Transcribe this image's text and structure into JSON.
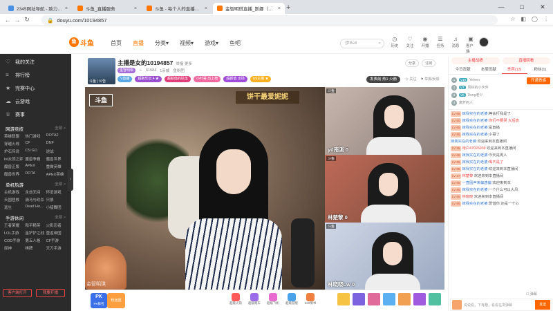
{
  "browser": {
    "tabs": [
      {
        "title": "2345网址导航 - 致力于打造百年品牌",
        "color": "#4a90e2"
      },
      {
        "title": "斗鱼_直播服务",
        "color": "#f70"
      },
      {
        "title": "斗鱼 - 每个人的直播平台",
        "color": "#f70"
      },
      {
        "title": "金智明琪直播_斯娜（揭秘） ",
        "color": "#f70"
      }
    ],
    "close_glyph": "×",
    "new_tab": "+",
    "url": "douyu.com/10194857",
    "window_controls": [
      "—",
      "□",
      "✕"
    ]
  },
  "site": {
    "logo_text": "斗鱼",
    "nav": [
      {
        "label": "首页",
        "active": false
      },
      {
        "label": "直播",
        "active": true
      },
      {
        "label": "分类▾",
        "active": false
      },
      {
        "label": "视频▾",
        "active": false
      },
      {
        "label": "游戏▾",
        "active": false
      },
      {
        "label": "鱼吧",
        "active": false
      }
    ],
    "search_placeholder": "伊Bell",
    "top_icons": [
      {
        "icon": "clock-icon",
        "glyph": "◷",
        "label": "历史"
      },
      {
        "icon": "heart-icon",
        "glyph": "♡",
        "label": "关注"
      },
      {
        "icon": "broadcast-icon",
        "glyph": "◉",
        "label": "开播"
      },
      {
        "icon": "task-icon",
        "glyph": "☰",
        "label": "任务"
      },
      {
        "icon": "bell-icon",
        "glyph": "♫",
        "label": "消息"
      },
      {
        "icon": "app-icon",
        "glyph": "▣",
        "label": "客户端"
      }
    ]
  },
  "sidebar": {
    "items": [
      {
        "icon": "heart-icon",
        "glyph": "♡",
        "label": "我的关注"
      },
      {
        "icon": "rank-icon",
        "glyph": "≡",
        "label": "排行榜"
      },
      {
        "icon": "event-icon",
        "glyph": "★",
        "label": "完赛中心"
      },
      {
        "icon": "cloud-icon",
        "glyph": "☁",
        "label": "云游戏"
      },
      {
        "icon": "trophy-icon",
        "glyph": "♕",
        "label": "赛事"
      }
    ],
    "sections": [
      {
        "title": "网游竞技",
        "more": "全部 >",
        "games": [
          "英雄联盟",
          "热门游戏",
          "DOTA2",
          "穿越火线",
          "CF",
          "DNF",
          "炉石传说",
          "CS:GO",
          "逆战",
          "lol云顶之弈",
          "魔兽争霸",
          "魔兽世界",
          "魔兽正版",
          "APEX",
          "重做英雄",
          "魔兽世界",
          "DOTA",
          "APEX英雄"
        ]
      },
      {
        "title": "单机热游",
        "more": "全部 >",
        "games": [
          "主机游戏",
          "永劫无间",
          "怀旧游戏",
          "天国拯救",
          "骑马与砍杀",
          "只狼",
          "逃生",
          "Dead Ho...",
          "小猎舞团"
        ]
      },
      {
        "title": "手游休闲",
        "more": "全部 >",
        "games": [
          "王者荣耀",
          "和平精英",
          "火影忍者",
          "LOL手游",
          "金铲铲之战",
          "重返帝国",
          "COD手游",
          "第五人格",
          "CF手游",
          "原神",
          "棋牌",
          "天刀手游"
        ]
      }
    ],
    "bottom_buttons": [
      "客户端打开",
      "我要开播"
    ]
  },
  "room": {
    "thumb_label": "斗鱼 | 公告",
    "title": "主播是女的10194857",
    "title_sub": "举报  更多",
    "badge": "金智明琪",
    "meta": [
      "61584",
      "1亲戚",
      "鱼粉团"
    ],
    "tags": [
      {
        "label": "V直播",
        "color": "#5aa9e6"
      },
      {
        "label": "超跑乐坛 4 ★",
        "color": "#9b4fd1"
      },
      {
        "label": "超颜值的队伍",
        "color": "#e0407a"
      },
      {
        "label": "小叶哥 出上榜",
        "color": "#f06aa0"
      },
      {
        "label": "超颜值 出场",
        "color": "#9f4dd8"
      },
      {
        "label": "lv6主播 ★",
        "color": "#ffb020"
      }
    ],
    "rank_pill": "发表前 热1 火箭",
    "header_buttons": [
      "分享",
      "订阅"
    ],
    "header_ops": [
      "☆ 关注",
      "⚑ 举报/反馈"
    ]
  },
  "player": {
    "logo": "斗鱼",
    "caption": "饼干最爱妮妮",
    "watermark": "金智明琪",
    "subs": [
      {
        "name": "yd南溪 0",
        "tag": "斗鱼"
      },
      {
        "name": "林楚黎 0",
        "tag": "斗鱼"
      },
      {
        "name": "林晓晓Lw 0",
        "tag": "斗鱼"
      }
    ]
  },
  "giftbar": {
    "pk_title": "PK",
    "pk_sub": "PK排名",
    "fan": "粉丝团",
    "gifts": [
      "超级火箭",
      "超级跑车",
      "超级飞机",
      "超级游艇",
      "520情书"
    ],
    "gift_colors": [
      "#ff5a5a",
      "#9c6ce8",
      "#e86cd0",
      "#4aa3e8",
      "#f08040"
    ],
    "gifts2_colors": [
      "#f6c343",
      "#7d62e0",
      "#e06b9a",
      "#5ab0f0",
      "#f0a050",
      "#a05ae0",
      "#50c0a0"
    ]
  },
  "chat": {
    "top_buttons": [
      "主播战绩",
      "直播回看"
    ],
    "tabs": [
      {
        "label": "今日贡献",
        "active": false
      },
      {
        "label": "本周贡献",
        "active": false
      },
      {
        "label": "贵宾(13)",
        "active": true
      },
      {
        "label": "粉丝(1)",
        "active": false
      }
    ],
    "open_button": "开通贵族",
    "ranks": [
      {
        "n": "1",
        "lv": "V10",
        "name": "Yelven"
      },
      {
        "n": "2",
        "lv": "V7",
        "name": "风铃的小伙伴"
      },
      {
        "n": "3",
        "lv": "V5",
        "name": "Dong老少"
      },
      {
        "n": "4",
        "lv": "",
        "name": "离开的人"
      }
    ],
    "messages": [
      {
        "lv": "LV 65",
        "user": "嫁我实在的老婆:",
        "text": "等会打我是了"
      },
      {
        "lv": "LV 50",
        "user": "嫁我实在的老婆:",
        "text": "你们不要哭 大后放"
      },
      {
        "lv": "LV 65",
        "user": "嫁我实在的老婆:",
        "text": "是直播"
      },
      {
        "lv": "LV 65",
        "user": "嫁我实在的老婆:",
        "text": "小哥了"
      },
      {
        "lv": "",
        "user": "嫁我实在的老婆:",
        "text": "欢迎来到本直播间"
      },
      {
        "lv": "LV 25",
        "user": "用户47026939",
        "text": "欢迎来到本直播间"
      },
      {
        "lv": "LV 66",
        "user": "嫁我实在的老婆:",
        "text": "今天是周人"
      },
      {
        "lv": "LV 65",
        "user": "嫁我实在的老婆:",
        "text": "喝不是了"
      },
      {
        "lv": "LV 65",
        "user": "嫁我实在的老婆:",
        "text": "欢迎来到本直播间"
      },
      {
        "lv": "LV 27",
        "user": "林楚黎",
        "text": "欢迎来到本直播间"
      },
      {
        "lv": "LV 65",
        "user": "一直图声来偏唐偏",
        "text": "欢迎来到本"
      },
      {
        "lv": "LV 65",
        "user": "嫁我实在的老婆:",
        "text": "一个什么可以大风"
      },
      {
        "lv": "LV 55",
        "user": "林晓晓",
        "text": "欢迎来到本直播间"
      },
      {
        "lv": "LV 65",
        "user": "嫁我实在的老婆:",
        "text": "爱惜你 还是一个心"
      }
    ],
    "input_placeholder": "说说看，下有趣，看看在发弹幕",
    "send": "发送",
    "check_label": "弹幕"
  }
}
